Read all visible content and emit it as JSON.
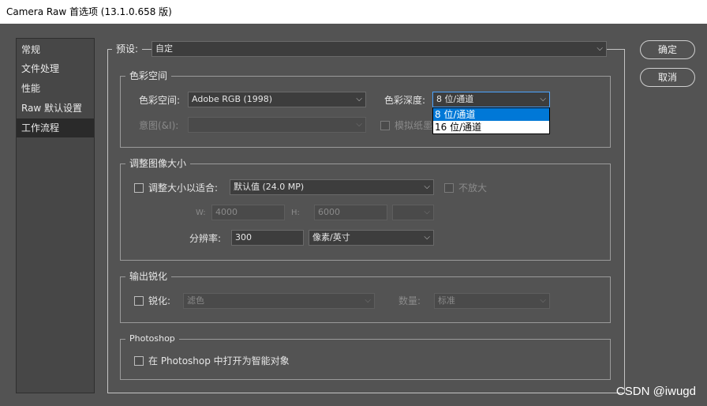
{
  "window": {
    "title": "Camera Raw 首选项  (13.1.0.658 版)"
  },
  "sidebar": {
    "items": [
      {
        "label": "常规"
      },
      {
        "label": "文件处理"
      },
      {
        "label": "性能"
      },
      {
        "label": "Raw 默认设置"
      },
      {
        "label": "工作流程"
      }
    ]
  },
  "preset": {
    "label": "预设:",
    "value": "自定"
  },
  "buttons": {
    "ok": "确定",
    "cancel": "取消"
  },
  "color_space": {
    "legend": "色彩空间",
    "space_label": "色彩空间:",
    "space_value": "Adobe RGB (1998)",
    "depth_label": "色彩深度:",
    "depth_value": "8 位/通道",
    "depth_options": [
      "8 位/通道",
      "16 位/通道"
    ],
    "intent_label": "意图(&I):",
    "simulate_label": "模拟纸墨"
  },
  "resize": {
    "legend": "调整图像大小",
    "fit_label": "调整大小以适合:",
    "fit_value": "默认值 (24.0 MP)",
    "no_enlarge": "不放大",
    "w_label": "W:",
    "w_value": "4000",
    "h_label": "H:",
    "h_value": "6000",
    "resolution_label": "分辨率:",
    "resolution_value": "300",
    "resolution_unit": "像素/英寸"
  },
  "sharpen": {
    "legend": "输出锐化",
    "label": "锐化:",
    "target": "滤色",
    "amount_label": "数量:",
    "amount_value": "标准"
  },
  "photoshop": {
    "legend": "Photoshop",
    "smart_object_label": "在 Photoshop 中打开为智能对象"
  },
  "watermark": "CSDN @iwugd"
}
